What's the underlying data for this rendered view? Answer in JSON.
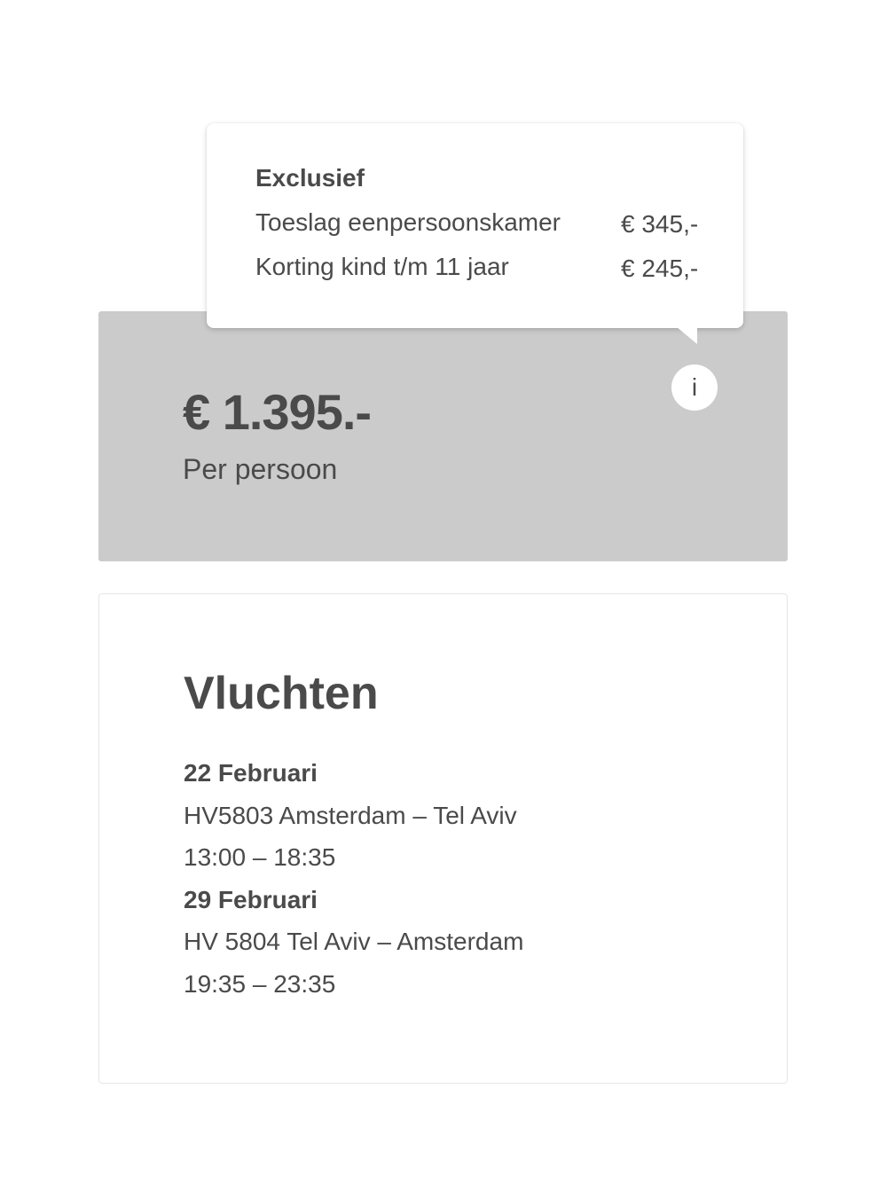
{
  "price": {
    "amount": "€ 1.395.-",
    "subtitle": "Per persoon",
    "info_icon": "i"
  },
  "tooltip": {
    "title": "Exclusief",
    "rows": [
      {
        "label": "Toeslag eenpersoonskamer",
        "value": "€ 345,-"
      },
      {
        "label": "Korting kind t/m 11 jaar",
        "value": "€ 245,-"
      }
    ]
  },
  "flights": {
    "title": "Vluchten",
    "items": [
      {
        "date": "22 Februari",
        "route": "HV5803 Amsterdam – Tel Aviv",
        "time": "13:00 – 18:35"
      },
      {
        "date": "29 Februari",
        "route": "HV 5804 Tel Aviv – Amsterdam",
        "time": "19:35 – 23:35"
      }
    ]
  },
  "colors": {
    "text": "#4a4a4a",
    "panel": "#cbcbcb",
    "card_border": "#e6e6e6"
  }
}
